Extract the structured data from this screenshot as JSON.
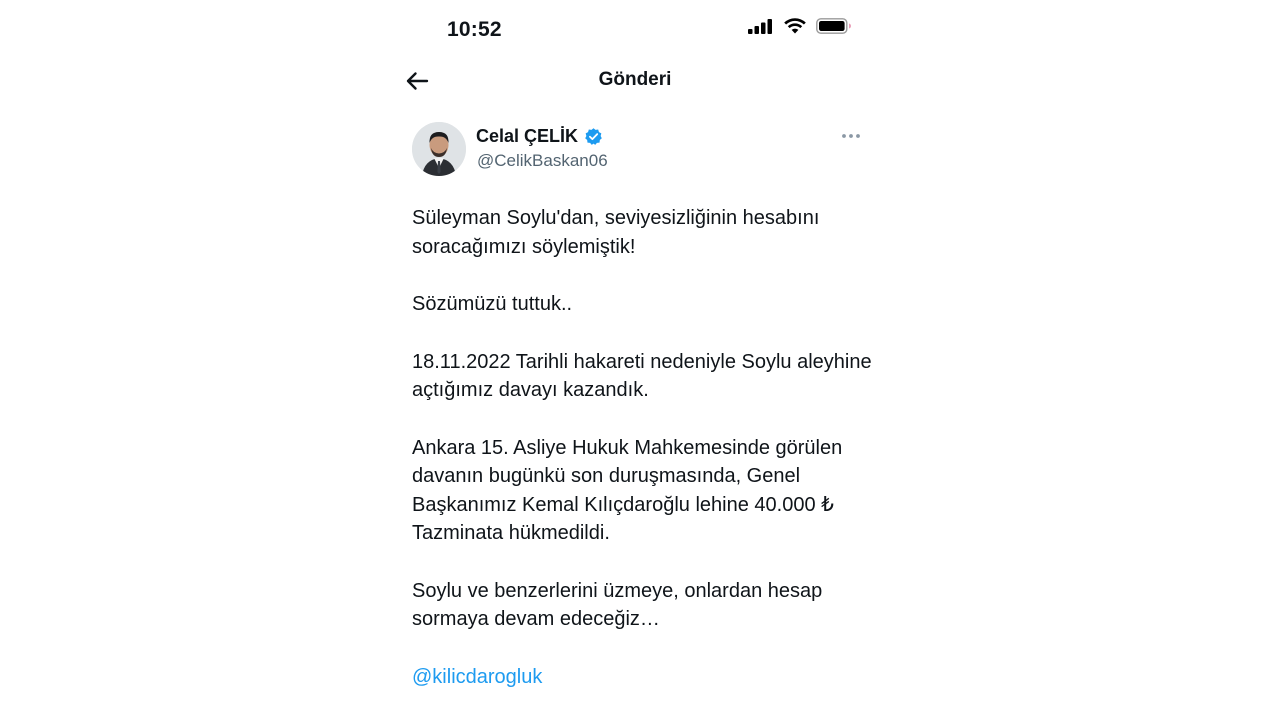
{
  "status_bar": {
    "time": "10:52"
  },
  "header": {
    "title": "Gönderi"
  },
  "author": {
    "name": "Celal ÇELİK",
    "handle": "@CelikBaskan06"
  },
  "tweet": {
    "paragraphs": [
      "Süleyman Soylu'dan, seviyesizliğinin hesabını soracağımızı söylemiştik!",
      "Sözümüzü tuttuk..",
      "18.11.2022 Tarihli hakareti nedeniyle Soylu aleyhine açtığımız davayı kazandık.",
      "Ankara 15. Asliye Hukuk Mahkemesinde görülen davanın bugünkü son duruşmasında, Genel Başkanımız Kemal Kılıçdaroğlu lehine 40.000 ₺ Tazminata hükmedildi.",
      "Soylu ve benzerlerini üzmeye, onlardan hesap sormaya devam edeceğiz…"
    ],
    "mention": "@kilicdarogluk"
  },
  "icons": {
    "back": "arrow-left-icon",
    "verified": "verified-badge-icon",
    "more": "more-horizontal-icon",
    "signal": "signal-icon",
    "wifi": "wifi-icon",
    "battery": "battery-icon"
  },
  "colors": {
    "accent": "#1d9bf0",
    "text": "#0f1419",
    "secondary": "#536471"
  }
}
